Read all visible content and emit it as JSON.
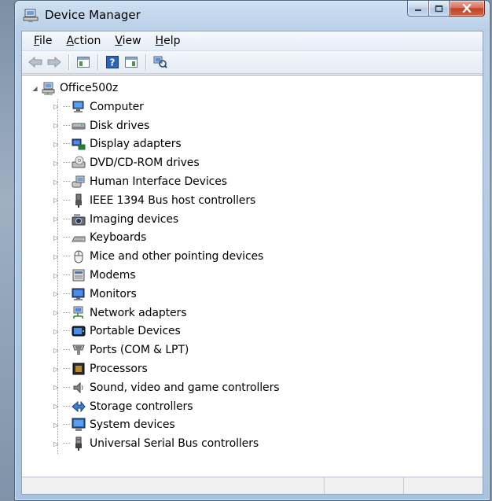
{
  "window": {
    "title": "Device Manager",
    "colors": {
      "accent": "#b9d0e8",
      "close": "#c0412a"
    }
  },
  "menu": [
    {
      "label": "File",
      "mnemonic": "F",
      "rest": "ile"
    },
    {
      "label": "Action",
      "mnemonic": "A",
      "rest": "ction"
    },
    {
      "label": "View",
      "mnemonic": "V",
      "rest": "iew"
    },
    {
      "label": "Help",
      "mnemonic": "H",
      "rest": "elp"
    }
  ],
  "toolbar": {
    "buttons": [
      "back-arrow-icon",
      "forward-arrow-icon",
      "show-hide-console-tree-icon",
      "help-icon",
      "properties-pane-icon",
      "scan-hardware-icon"
    ]
  },
  "tree": {
    "root": {
      "label": "Office500z",
      "icon": "computer-network-icon",
      "expanded": true
    },
    "children": [
      {
        "label": "Computer",
        "icon": "computer-icon"
      },
      {
        "label": "Disk drives",
        "icon": "disk-drive-icon"
      },
      {
        "label": "Display adapters",
        "icon": "display-adapter-icon"
      },
      {
        "label": "DVD/CD-ROM drives",
        "icon": "dvd-drive-icon"
      },
      {
        "label": "Human Interface Devices",
        "icon": "hid-icon"
      },
      {
        "label": "IEEE 1394 Bus host controllers",
        "icon": "ieee1394-icon"
      },
      {
        "label": "Imaging devices",
        "icon": "camera-icon"
      },
      {
        "label": "Keyboards",
        "icon": "keyboard-icon"
      },
      {
        "label": "Mice and other pointing devices",
        "icon": "mouse-icon"
      },
      {
        "label": "Modems",
        "icon": "modem-icon"
      },
      {
        "label": "Monitors",
        "icon": "monitor-icon"
      },
      {
        "label": "Network adapters",
        "icon": "network-adapter-icon"
      },
      {
        "label": "Portable Devices",
        "icon": "portable-device-icon"
      },
      {
        "label": "Ports (COM & LPT)",
        "icon": "port-icon"
      },
      {
        "label": "Processors",
        "icon": "processor-icon"
      },
      {
        "label": "Sound, video and game controllers",
        "icon": "speaker-icon"
      },
      {
        "label": "Storage controllers",
        "icon": "storage-controller-icon"
      },
      {
        "label": "System devices",
        "icon": "system-device-icon"
      },
      {
        "label": "Universal Serial Bus controllers",
        "icon": "usb-icon"
      }
    ]
  }
}
